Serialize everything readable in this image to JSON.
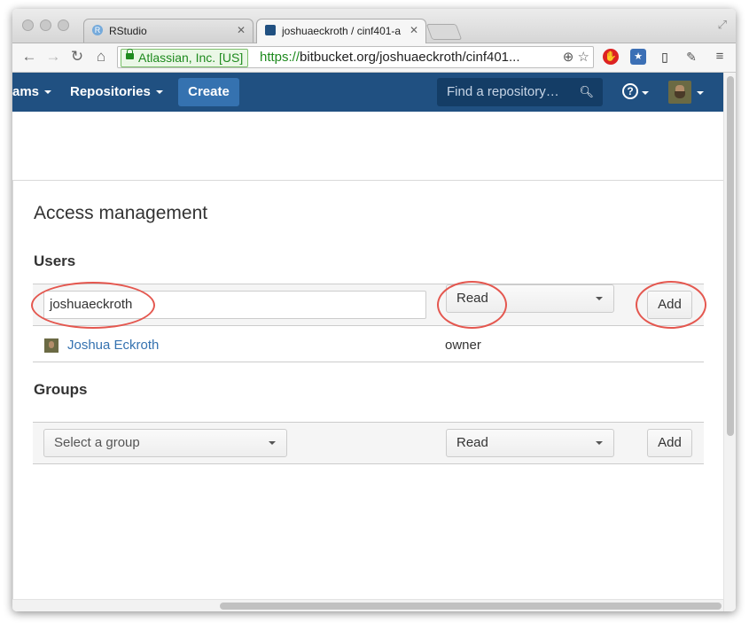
{
  "browser": {
    "tabs": [
      {
        "title": "RStudio",
        "favicon": "rstudio-favicon",
        "active": false
      },
      {
        "title": "joshuaeckroth / cinf401-a",
        "favicon": "bitbucket-favicon",
        "active": true
      }
    ],
    "ev_label": "Atlassian, Inc. [US]",
    "url_scheme": "https://",
    "url_rest": "bitbucket.org/joshuaeckroth/cinf401...",
    "icons": {
      "back": "back-arrow-icon",
      "forward": "forward-arrow-icon",
      "reload": "reload-icon",
      "home": "home-icon",
      "zoom": "zoom-icon",
      "bookmark": "star-icon"
    }
  },
  "navbar": {
    "teams_label": "ams",
    "repositories_label": "Repositories",
    "create_label": "Create",
    "search_placeholder": "Find a repository…",
    "help_glyph": "?",
    "background": "#205081"
  },
  "page": {
    "title": "Access management",
    "users": {
      "heading": "Users",
      "input_value": "joshuaeckroth",
      "permission": "Read",
      "add_label": "Add",
      "members": [
        {
          "name": "Joshua Eckroth",
          "role": "owner"
        }
      ]
    },
    "groups": {
      "heading": "Groups",
      "select_placeholder": "Select a group",
      "permission": "Read",
      "add_label": "Add"
    }
  },
  "annotation_color": "#e4574f"
}
